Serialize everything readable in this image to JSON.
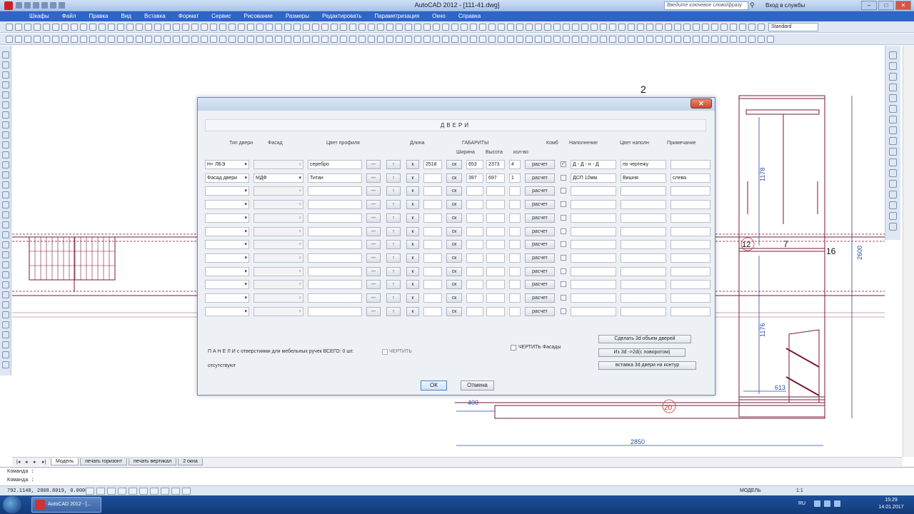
{
  "app": {
    "window_title": "AutoCAD 2012 - [111-41.dwg]",
    "help_search_placeholder": "Введите ключевое слово/фразу",
    "services_label": "Вход в службы"
  },
  "menu": [
    "Шкафы",
    "Файл",
    "Правка",
    "Вид",
    "Вставка",
    "Формат",
    "Сервис",
    "Рисование",
    "Размеры",
    "Редактировать",
    "Параметризация",
    "Окно",
    "Справка"
  ],
  "toolbar": {
    "text_style": "Standard"
  },
  "drawing": {
    "labels": {
      "top_num": "2",
      "num_12": "12",
      "num_7": "7",
      "num_16": "16",
      "num_20": "20",
      "dim_2600": "2600",
      "dim_1178": "1178",
      "dim_1176": "1176",
      "dim_613": "613",
      "dim_400": "400",
      "dim_2850": "2850"
    }
  },
  "layout_tabs": [
    "Модель",
    "печать горизонт",
    "печать вертикал",
    "2 окна"
  ],
  "command_lines": [
    "Команда :",
    "Команда :"
  ],
  "status": {
    "coords": "792.1140, 2808.8019, 0.0000",
    "model": "МОДЕЛЬ",
    "scale": "1:1"
  },
  "taskbar": {
    "app_label": "AutoCAD 2012 - [...",
    "lang": "RU",
    "time": "15:29",
    "date": "14.01.2017"
  },
  "dialog": {
    "title": "ДВЕРИ",
    "headers": {
      "type": "Тип двери",
      "facade": "Фасад",
      "profile_color": "Цвет профиля",
      "length": "Длина",
      "dimensions": "ГАБАРИТЫ",
      "width": "Ширина",
      "height": "Высота",
      "qty": "кол-во",
      "combo": "Комб",
      "fill": "Наполнение",
      "fill_color": "Цвет наполн",
      "note": "Примечание"
    },
    "button_labels": {
      "dash": "---",
      "up": "↑",
      "k": "к",
      "sk": "ск",
      "calc": "расчет"
    },
    "rows": [
      {
        "type": "Н+ ЛБЭ",
        "facade": "",
        "profile_color": "серебро",
        "length": "2518",
        "width": "653",
        "height": "2373",
        "qty": "4",
        "checked": "✓",
        "fill": "Д - Д - н - Д",
        "fill_color": "по чертежу",
        "note": ""
      },
      {
        "type": "Фасад двери",
        "facade": "МДФ",
        "profile_color": "Титан",
        "length": "",
        "width": "397",
        "height": "697",
        "qty": "1",
        "checked": "",
        "fill": "ДСП 10мм",
        "fill_color": "Вишня",
        "note": "слева"
      },
      {
        "type": "",
        "facade": "",
        "profile_color": "",
        "length": "",
        "width": "",
        "height": "",
        "qty": "",
        "checked": "",
        "fill": "",
        "fill_color": "",
        "note": ""
      },
      {
        "type": "",
        "facade": "",
        "profile_color": "",
        "length": "",
        "width": "",
        "height": "",
        "qty": "",
        "checked": "",
        "fill": "",
        "fill_color": "",
        "note": ""
      },
      {
        "type": "",
        "facade": "",
        "profile_color": "",
        "length": "",
        "width": "",
        "height": "",
        "qty": "",
        "checked": "",
        "fill": "",
        "fill_color": "",
        "note": ""
      },
      {
        "type": "",
        "facade": "",
        "profile_color": "",
        "length": "",
        "width": "",
        "height": "",
        "qty": "",
        "checked": "",
        "fill": "",
        "fill_color": "",
        "note": ""
      },
      {
        "type": "",
        "facade": "",
        "profile_color": "",
        "length": "",
        "width": "",
        "height": "",
        "qty": "",
        "checked": "",
        "fill": "",
        "fill_color": "",
        "note": ""
      },
      {
        "type": "",
        "facade": "",
        "profile_color": "",
        "length": "",
        "width": "",
        "height": "",
        "qty": "",
        "checked": "",
        "fill": "",
        "fill_color": "",
        "note": ""
      },
      {
        "type": "",
        "facade": "",
        "profile_color": "",
        "length": "",
        "width": "",
        "height": "",
        "qty": "",
        "checked": "",
        "fill": "",
        "fill_color": "",
        "note": ""
      },
      {
        "type": "",
        "facade": "",
        "profile_color": "",
        "length": "",
        "width": "",
        "height": "",
        "qty": "",
        "checked": "",
        "fill": "",
        "fill_color": "",
        "note": ""
      },
      {
        "type": "",
        "facade": "",
        "profile_color": "",
        "length": "",
        "width": "",
        "height": "",
        "qty": "",
        "checked": "",
        "fill": "",
        "fill_color": "",
        "note": ""
      },
      {
        "type": "",
        "facade": "",
        "profile_color": "",
        "length": "",
        "width": "",
        "height": "",
        "qty": "",
        "checked": "",
        "fill": "",
        "fill_color": "",
        "note": ""
      }
    ],
    "panels_text": "П А Н Е Л И с отверстиями для мебельных ручек ВСЕГО: 0 шт.",
    "panels_draw_label": "ЧЕРТИТЬ",
    "missing_text": "отсутствуют",
    "draw_facades_label": "ЧЕРТИТЬ Фасады",
    "actions": {
      "make_3d": "Сделать 3d объем дверей",
      "from_3d": "Из 3d ->2d(с поворотом)",
      "insert_3d": "вставка 3d двери на контур"
    },
    "ok_label": "ОК",
    "cancel_label": "Отмена"
  },
  "colors": {
    "menu_bg": "#2f64c8",
    "drawing_line": "#7a1a3a",
    "dim_blue": "#2a4aa0"
  }
}
